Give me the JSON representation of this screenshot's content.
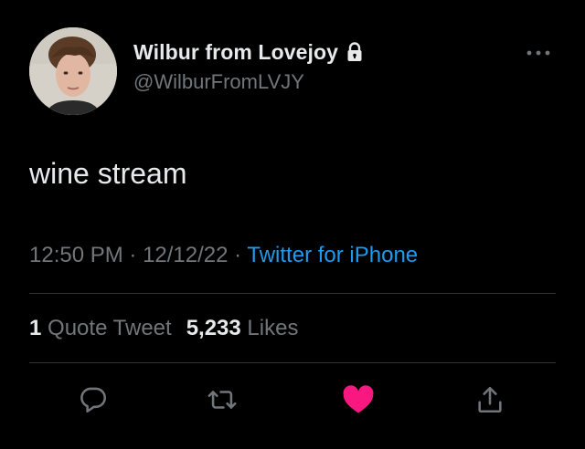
{
  "user": {
    "display_name": "Wilbur from Lovejoy",
    "handle": "@WilburFromLVJY",
    "avatar_icon": "profile-photo",
    "protected_icon": "lock-icon"
  },
  "tweet": {
    "text": "wine stream",
    "time": "12:50 PM",
    "separator": " · ",
    "date": "12/12/22",
    "source": "Twitter for iPhone"
  },
  "stats": {
    "quote_count": "1",
    "quote_label": "Quote Tweet",
    "likes_count": "5,233",
    "likes_label": "Likes"
  },
  "actions": {
    "reply_icon": "reply-icon",
    "retweet_icon": "retweet-icon",
    "like_icon": "heart-icon",
    "share_icon": "share-icon"
  },
  "colors": {
    "background": "#000000",
    "text_primary": "#e7e9ea",
    "text_secondary": "#71767b",
    "link": "#1d9bf0",
    "like": "#f91880",
    "divider": "#2f3336"
  }
}
